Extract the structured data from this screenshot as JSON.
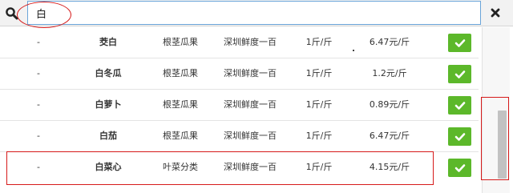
{
  "search": {
    "value": "白",
    "icon": "search-icon"
  },
  "close_icon": "close-icon",
  "rows": [
    {
      "dash": "-",
      "name_pre": "茭",
      "name_hl": "白",
      "name_post": "",
      "category": "根茎瓜果",
      "store": "深圳鲜度一百",
      "unit": "1斤/斤",
      "price": "6.47元/斤"
    },
    {
      "dash": "-",
      "name_pre": "",
      "name_hl": "白",
      "name_post": "冬瓜",
      "category": "根茎瓜果",
      "store": "深圳鲜度一百",
      "unit": "1斤/斤",
      "price": "1.2元/斤"
    },
    {
      "dash": "-",
      "name_pre": "",
      "name_hl": "白",
      "name_post": "萝卜",
      "category": "根茎瓜果",
      "store": "深圳鲜度一百",
      "unit": "1斤/斤",
      "price": "0.89元/斤"
    },
    {
      "dash": "-",
      "name_pre": "",
      "name_hl": "白",
      "name_post": "茄",
      "category": "根茎瓜果",
      "store": "深圳鲜度一百",
      "unit": "1斤/斤",
      "price": "6.47元/斤"
    },
    {
      "dash": "-",
      "name_pre": "",
      "name_hl": "白",
      "name_post": "菜心",
      "category": "叶菜分类",
      "store": "深圳鲜度一百",
      "unit": "1斤/斤",
      "price": "4.15元/斤"
    }
  ],
  "colors": {
    "accent_green": "#5cb82a",
    "annotation_red": "#d61a1a",
    "input_border": "#6aa4d9"
  }
}
